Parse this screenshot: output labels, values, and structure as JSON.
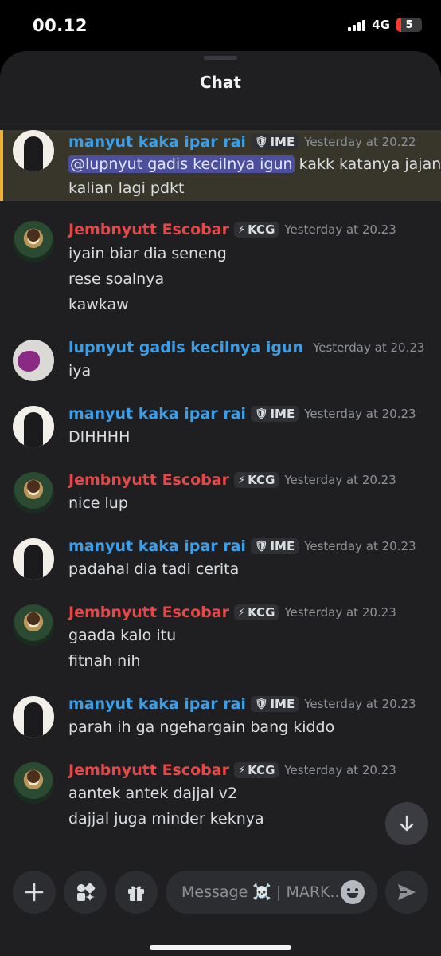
{
  "status": {
    "time": "00.12",
    "network": "4G",
    "battery": "5"
  },
  "header": {
    "title": "Chat"
  },
  "messages": [
    {
      "user": "manyut kaka ipar rai",
      "color": "#3c9ee6",
      "tag_icon": "shield-icon",
      "tag": "IME",
      "time": "Yesterday at 20.22",
      "highlight": true,
      "mention": "@lupnyut gadis kecilnya igun",
      "lines": [
        "kakk katanya jajang",
        "kalian lagi pdkt"
      ]
    },
    {
      "user": "Jembnyutt Escobar",
      "color": "#e54848",
      "tag_icon": "lightning-icon",
      "tag": "KCG",
      "time": "Yesterday at 20.23",
      "lines": [
        "iyain biar dia seneng",
        "rese soalnya",
        "kawkaw"
      ]
    },
    {
      "user": "lupnyut gadis kecilnya igun",
      "color": "#3c9ee6",
      "time": "Yesterday at 20.23",
      "lines": [
        "iya"
      ]
    },
    {
      "user": "manyut kaka ipar rai",
      "color": "#3c9ee6",
      "tag_icon": "shield-icon",
      "tag": "IME",
      "time": "Yesterday at 20.23",
      "lines": [
        "DIHHHH"
      ]
    },
    {
      "user": "Jembnyutt Escobar",
      "color": "#e54848",
      "tag_icon": "lightning-icon",
      "tag": "KCG",
      "time": "Yesterday at 20.23",
      "lines": [
        "nice lup"
      ]
    },
    {
      "user": "manyut kaka ipar rai",
      "color": "#3c9ee6",
      "tag_icon": "shield-icon",
      "tag": "IME",
      "time": "Yesterday at 20.23",
      "lines": [
        "padahal dia tadi cerita"
      ]
    },
    {
      "user": "Jembnyutt Escobar",
      "color": "#e54848",
      "tag_icon": "lightning-icon",
      "tag": "KCG",
      "time": "Yesterday at 20.23",
      "lines": [
        "gaada kalo itu",
        "fitnah nih"
      ]
    },
    {
      "user": "manyut kaka ipar rai",
      "color": "#3c9ee6",
      "tag_icon": "shield-icon",
      "tag": "IME",
      "time": "Yesterday at 20.23",
      "lines": [
        "parah ih ga ngehargain bang kiddo"
      ]
    },
    {
      "user": "Jembnyutt Escobar",
      "color": "#e54848",
      "tag_icon": "lightning-icon",
      "tag": "KCG",
      "time": "Yesterday at 20.23",
      "lines": [
        "aantek antek dajjal v2",
        "dajjal juga minder keknya"
      ]
    }
  ],
  "composer": {
    "placeholder": "Message ☠️ | MARK..."
  }
}
